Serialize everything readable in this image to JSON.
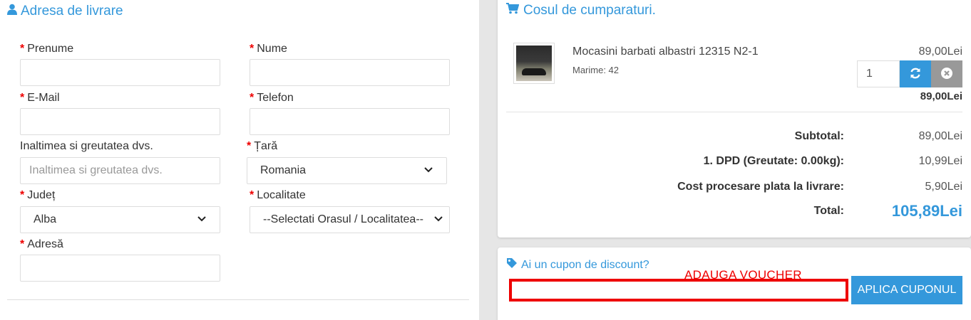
{
  "delivery": {
    "title": "Adresa de livrare",
    "icon": "user-icon",
    "required_mark": "*",
    "fields": {
      "prenume": {
        "label": "Prenume",
        "value": ""
      },
      "nume": {
        "label": "Nume",
        "value": ""
      },
      "email": {
        "label": "E-Mail",
        "value": ""
      },
      "telefon": {
        "label": "Telefon",
        "value": ""
      },
      "inaltime": {
        "label": "Inaltimea si greutatea dvs.",
        "placeholder": "Inaltimea si greutatea dvs."
      },
      "tara": {
        "label": "Țară",
        "value": "Romania"
      },
      "judet": {
        "label": "Județ",
        "value": "Alba"
      },
      "localitate": {
        "label": "Localitate",
        "value": "--Selectati Orasul / Localitatea--"
      },
      "adresa": {
        "label": "Adresă",
        "value": ""
      }
    }
  },
  "cart": {
    "title": "Cosul de cumparaturi.",
    "icon": "shopping-cart-icon",
    "item": {
      "name": "Mocasini barbati albastri 12315 N2-1",
      "size": "Marime: 42",
      "unit_price": "89,00Lei",
      "quantity": "1",
      "line_total": "89,00Lei"
    },
    "summary": {
      "subtotal_label": "Subtotal:",
      "subtotal_value": "89,00Lei",
      "shipping_label": "1. DPD (Greutate: 0.00kg):",
      "shipping_value": "10,99Lei",
      "processing_label": "Cost procesare plata la livrare:",
      "processing_value": "5,90Lei",
      "total_label": "Total:",
      "total_value": "105,89Lei"
    }
  },
  "coupon": {
    "question": "Ai un cupon de discount?",
    "icon": "tag-icon",
    "annotation": "ADAUGA VOUCHER",
    "input_value": "",
    "apply_label": "APLICA CUPONUL"
  },
  "colors": {
    "accent": "#3498db",
    "required": "#e00000",
    "highlight_border": "#e00000",
    "remove_button": "#999999"
  }
}
